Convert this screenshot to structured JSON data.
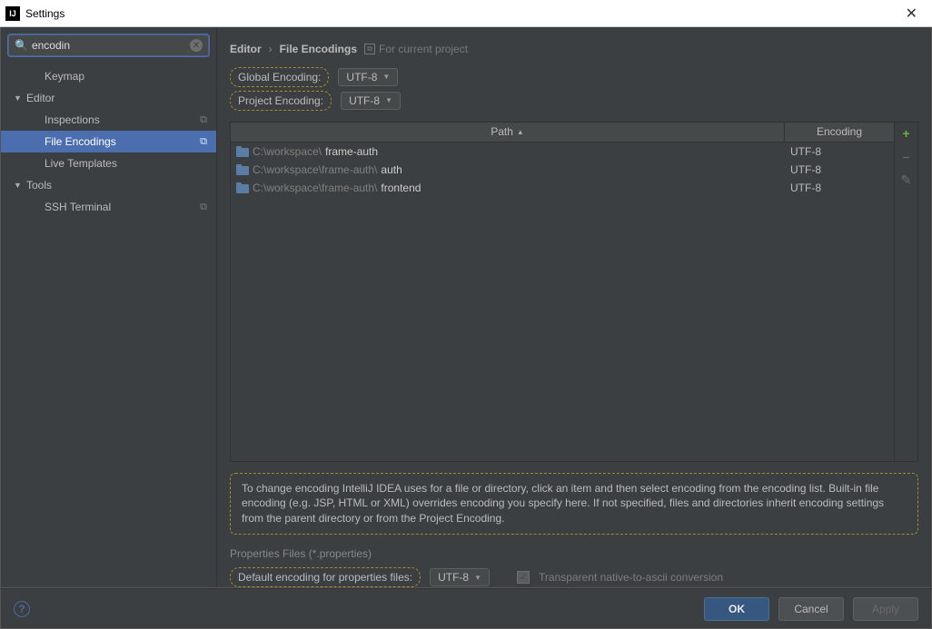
{
  "window": {
    "title": "Settings"
  },
  "search": {
    "value": "encodin"
  },
  "sidebar": {
    "items": [
      {
        "label": "Keymap",
        "level": 2,
        "copy": false,
        "expand": false
      },
      {
        "label": "Editor",
        "level": 1,
        "copy": false,
        "expand": true
      },
      {
        "label": "Inspections",
        "level": 2,
        "copy": true,
        "expand": false
      },
      {
        "label": "File Encodings",
        "level": 2,
        "copy": true,
        "selected": true
      },
      {
        "label": "Live Templates",
        "level": 2,
        "copy": false
      },
      {
        "label": "Tools",
        "level": 1,
        "copy": false,
        "expand": true
      },
      {
        "label": "SSH Terminal",
        "level": 2,
        "copy": true
      }
    ]
  },
  "breadcrumb": {
    "seg1": "Editor",
    "seg2": "File Encodings",
    "context": "For current project"
  },
  "encodings": {
    "global_label": "Global Encoding:",
    "global_value": "UTF-8",
    "project_label": "Project Encoding:",
    "project_value": "UTF-8"
  },
  "table": {
    "col_path": "Path",
    "col_enc": "Encoding",
    "rows": [
      {
        "dim": "C:\\workspace\\",
        "lit": "frame-auth",
        "enc": "UTF-8"
      },
      {
        "dim": "C:\\workspace\\frame-auth\\",
        "lit": "auth",
        "enc": "UTF-8"
      },
      {
        "dim": "C:\\workspace\\frame-auth\\",
        "lit": "frontend",
        "enc": "UTF-8"
      }
    ]
  },
  "note": "To change encoding IntelliJ IDEA uses for a file or directory, click an item and then select encoding from the encoding list. Built-in file encoding (e.g. JSP, HTML or XML) overrides encoding you specify here. If not specified, files and directories inherit encoding settings from the parent directory or from the Project Encoding.",
  "props": {
    "section": "Properties Files (*.properties)",
    "default_label": "Default encoding for properties files:",
    "default_value": "UTF-8",
    "checkbox_label": "Transparent native-to-ascii conversion"
  },
  "buttons": {
    "ok": "OK",
    "cancel": "Cancel",
    "apply": "Apply"
  }
}
